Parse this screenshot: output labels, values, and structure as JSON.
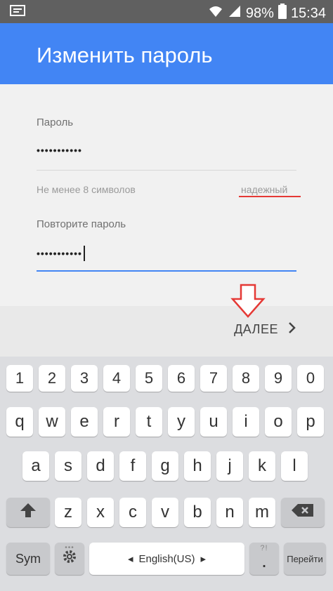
{
  "status_bar": {
    "battery": "98%",
    "time": "15:34",
    "icons": [
      "screen-icon",
      "wifi-icon",
      "signal-icon",
      "battery-icon"
    ]
  },
  "app_bar": {
    "title": "Изменить пароль"
  },
  "form": {
    "password_label": "Пароль",
    "password_value": "•••••••••••",
    "hint": "Не менее 8 символов",
    "strength": "надежный",
    "repeat_label": "Повторите пароль",
    "repeat_value": "•••••••••••"
  },
  "footer": {
    "next_label": "ДАЛЕЕ"
  },
  "keyboard": {
    "number_row": [
      "1",
      "2",
      "3",
      "4",
      "5",
      "6",
      "7",
      "8",
      "9",
      "0"
    ],
    "row1": [
      "q",
      "w",
      "e",
      "r",
      "t",
      "y",
      "u",
      "i",
      "o",
      "p"
    ],
    "row2": [
      "a",
      "s",
      "d",
      "f",
      "g",
      "h",
      "j",
      "k",
      "l"
    ],
    "row3": [
      "z",
      "x",
      "c",
      "v",
      "b",
      "n",
      "m"
    ],
    "sym_label": "Sym",
    "space_label": "English(US)",
    "period_label": ".",
    "action_label": "Перейти"
  },
  "colors": {
    "accent": "#4285f4",
    "status_bar": "#606060",
    "strength_bar": "#e53935",
    "annotation_arrow": "#e53935"
  }
}
